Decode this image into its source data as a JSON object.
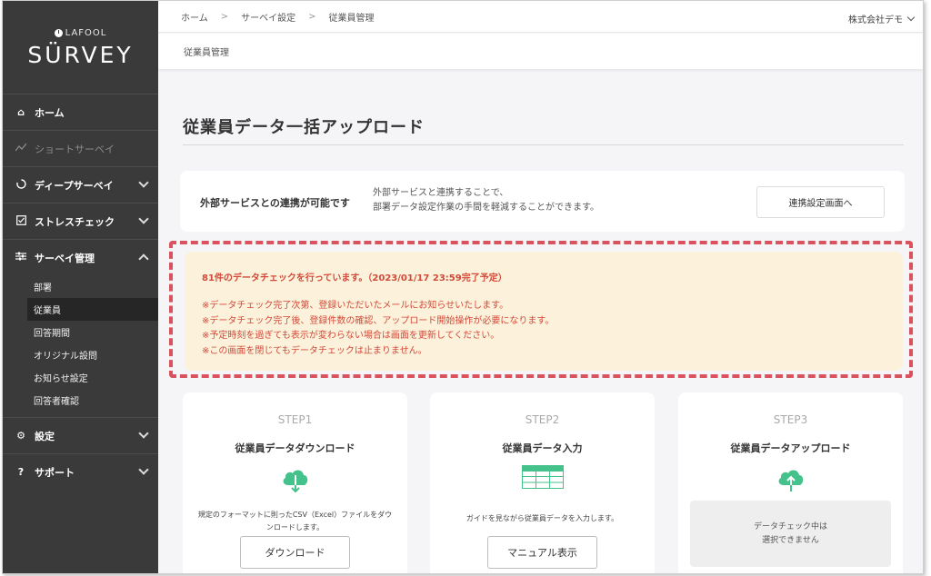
{
  "sidebar": {
    "logo_top": "LAFOOL",
    "logo_main": "SÜRVEY",
    "items": [
      {
        "label": "ホーム",
        "icon": "home-icon"
      },
      {
        "label": "ショートサーベイ",
        "icon": "trend-line-icon"
      },
      {
        "label": "ディープサーベイ",
        "icon": "circle-arc-icon"
      },
      {
        "label": "ストレスチェック",
        "icon": "checkbox-icon"
      },
      {
        "label": "サーベイ管理",
        "icon": "sliders-icon"
      },
      {
        "label": "設定",
        "icon": "gear-icon"
      },
      {
        "label": "サポート",
        "icon": "question-icon"
      }
    ],
    "sub_items": [
      "部署",
      "従業員",
      "回答期間",
      "オリジナル設問",
      "お知らせ設定",
      "回答者確認"
    ]
  },
  "topbar": {
    "breadcrumb": [
      "ホーム",
      "サーベイ設定",
      "従業員管理"
    ],
    "company": "株式会社デモ"
  },
  "subbar": {
    "title": "従業員管理"
  },
  "main": {
    "title": "従業員データ一括アップロード",
    "external": {
      "title": "外部サービスとの連携が可能です",
      "desc1": "外部サービスと連携することで、",
      "desc2": "部署データ設定作業の手間を軽減することができます。",
      "button": "連携設定画面へ"
    },
    "notice": {
      "head": "81件のデータチェックを行っています。（2023/01/17 23:59完了予定）",
      "lines": [
        "※データチェック完了次第、登録いただいたメールにお知らせいたします。",
        "※データチェック完了後、登録件数の確認、アップロード開始操作が必要になります。",
        "※予定時刻を過ぎても表示が変わらない場合は画面を更新してください。",
        "※この画面を閉じてもデータチェックは止まりません。"
      ]
    },
    "steps": [
      {
        "label": "STEP1",
        "title": "従業員データダウンロード",
        "desc": "規定のフォーマットに則ったCSV（Excel）ファイルをダウンロードします。",
        "button": "ダウンロード"
      },
      {
        "label": "STEP2",
        "title": "従業員データ入力",
        "desc": "ガイドを見ながら従業員データを入力します。",
        "button": "マニュアル表示"
      },
      {
        "label": "STEP3",
        "title": "従業員データアップロード",
        "disabled1": "データチェック中は",
        "disabled2": "選択できません"
      }
    ]
  },
  "colors": {
    "accent_green": "#45c28c",
    "notice_red": "#d24a3a",
    "notice_bg": "#fcf1da",
    "sidebar_bg": "#3a3a3a"
  }
}
